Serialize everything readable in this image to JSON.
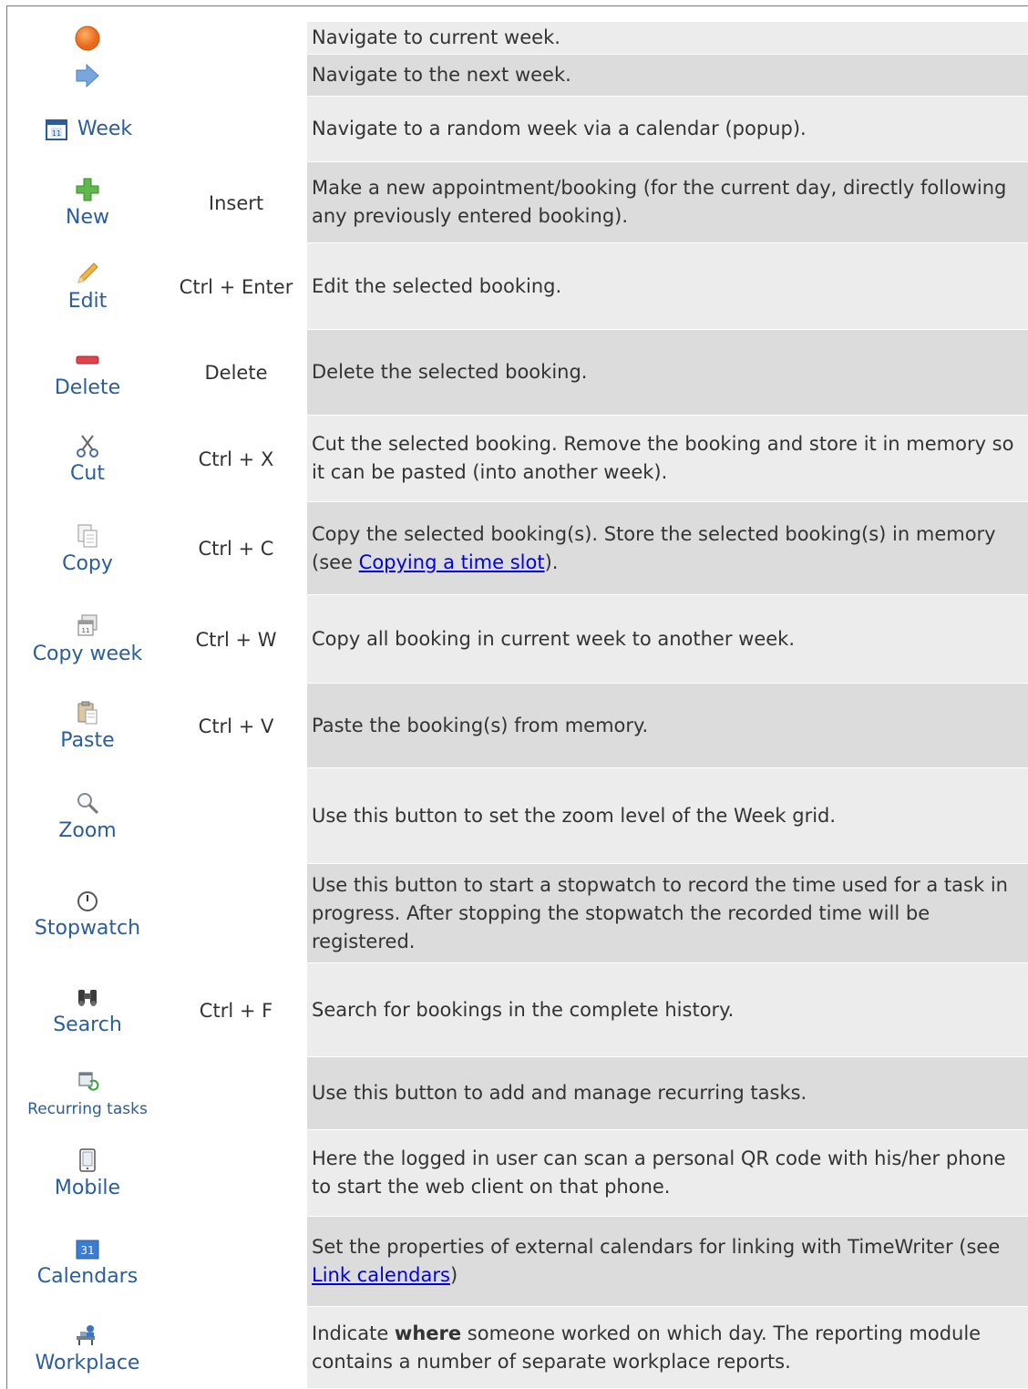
{
  "rows": [
    {
      "label": "",
      "key": "",
      "desc": "Navigate to current week.",
      "icon": "current-week-circle-icon"
    },
    {
      "label": "",
      "key": "",
      "desc": "Navigate to the next week.",
      "icon": "next-week-arrow-icon"
    },
    {
      "label": "Week",
      "key": "",
      "desc": "Navigate to a random week via a calendar (popup).",
      "icon": "calendar-icon"
    },
    {
      "label": "New",
      "key": "Insert",
      "desc": "Make a new appointment/booking (for the current day, directly following any previously entered booking).",
      "icon": "plus-icon"
    },
    {
      "label": "Edit",
      "key": "Ctrl + Enter",
      "desc": "Edit the selected booking.",
      "icon": "pencil-icon"
    },
    {
      "label": "Delete",
      "key": "Delete",
      "desc": "Delete the selected booking.",
      "icon": "minus-icon"
    },
    {
      "label": "Cut",
      "key": "Ctrl + X",
      "desc": "Cut the selected booking. Remove the booking and store it in memory so it can be pasted (into another week).",
      "icon": "scissors-icon"
    },
    {
      "label": "Copy",
      "key": "Ctrl + C",
      "desc_before": "Copy the selected booking(s). Store the selected booking(s) in memory (see ",
      "link": "Copying a time slot",
      "desc_after": ").",
      "icon": "copy-icon"
    },
    {
      "label": "Copy week",
      "key": "Ctrl + W",
      "desc": "Copy all booking in current week to another week.",
      "icon": "copy-week-icon"
    },
    {
      "label": "Paste",
      "key": "Ctrl + V",
      "desc": "Paste the booking(s) from memory.",
      "icon": "paste-icon"
    },
    {
      "label": "Zoom",
      "key": "",
      "desc": "Use this button to set the zoom level of the Week grid.",
      "icon": "magnifier-icon"
    },
    {
      "label": "Stopwatch",
      "key": "",
      "desc": "Use this button to start a stopwatch to record the time used for a task in progress. After stopping the stopwatch the recorded time will be registered.",
      "icon": "stopwatch-icon"
    },
    {
      "label": "Search",
      "key": "Ctrl + F",
      "desc": "Search for bookings in the complete history.",
      "icon": "binoculars-icon"
    },
    {
      "label": "Recurring tasks",
      "key": "",
      "desc": "Use this button to add and manage recurring tasks.",
      "icon": "recurring-tasks-icon"
    },
    {
      "label": "Mobile",
      "key": "",
      "desc": "Here the logged in user can scan a personal QR code with his/her phone to start the web client on that phone.",
      "icon": "mobile-phone-icon"
    },
    {
      "label": "Calendars",
      "key": "",
      "desc_before": "Set the properties of external calendars for linking with TimeWriter (see ",
      "link": "Link calendars",
      "desc_after": ")",
      "icon": "calendars-icon",
      "icon_text": "31"
    },
    {
      "label": "Workplace",
      "key": "",
      "desc_before": "Indicate ",
      "bold": "where",
      "desc_after": " someone worked on which day. The reporting module contains a number of separate workplace reports.",
      "icon": "workplace-icon"
    }
  ],
  "colors": {
    "label_blue": "#2a5d9a",
    "row_shade_dark": "#dcdcdc",
    "row_shade_light": "#ececec",
    "link": "#0000ee"
  }
}
